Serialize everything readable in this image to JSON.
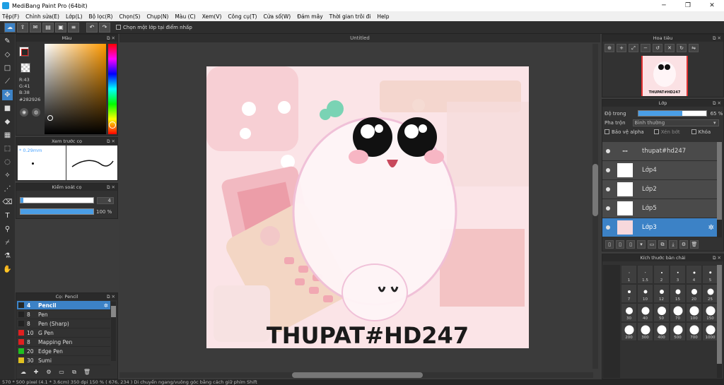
{
  "window": {
    "title": "MediBang Paint Pro (64bit)"
  },
  "menu": [
    "Tệp(F)",
    "Chỉnh sửa(E)",
    "Lớp(L)",
    "Bộ lọc(R)",
    "Chọn(S)",
    "Chụp(N)",
    "Màu (C)",
    "Xem(V)",
    "Công cụ(T)",
    "Cửa sổ(W)",
    "Đám mây",
    "Thời gian trôi đi",
    "Help"
  ],
  "toolbar": {
    "snap_label": "Chọn một lớp tại điểm nhấp"
  },
  "color_panel": {
    "title": "Màu",
    "r": "R:43",
    "g": "G:41",
    "b": "B:38",
    "hex": "#282926",
    "fg_color": "#282926",
    "base_hue": "#ff9a00"
  },
  "preview_panel": {
    "title": "Xem trước cọ",
    "size": "0.29mm"
  },
  "control_panel": {
    "title": "Kiểm soát cọ",
    "size_value": "4",
    "opacity_value": "100 %",
    "opacity_fraction": 1.0
  },
  "brush_panel": {
    "title": "Cọ: Pencil",
    "brushes": [
      {
        "num": "4",
        "name": "Pencil",
        "color": "#282926",
        "selected": true
      },
      {
        "num": "8",
        "name": "Pen",
        "color": "#222222"
      },
      {
        "num": "8",
        "name": "Pen (Sharp)",
        "color": "#222222"
      },
      {
        "num": "10",
        "name": "G Pen",
        "color": "#e02020"
      },
      {
        "num": "8",
        "name": "Mapping Pen",
        "color": "#e02020"
      },
      {
        "num": "20",
        "name": "Edge Pen",
        "color": "#20c020"
      },
      {
        "num": "30",
        "name": "Sumi",
        "color": "#e0c020"
      }
    ]
  },
  "canvas": {
    "tab_title": "Untitled",
    "watermark": "THUPAT#HD247"
  },
  "navigator": {
    "title": "Hoa tiêu",
    "thumb_label": "THUPAT#HD247"
  },
  "layer_panel": {
    "title": "Lớp",
    "opacity_label": "Độ trong",
    "opacity_value": "65 %",
    "opacity_fraction": 0.65,
    "blend_label": "Pha trộn",
    "blend_value": "Bình thường",
    "protect_alpha": "Bảo vệ alpha",
    "clipping": "Xén bớt",
    "lock": "Khóa",
    "layers": [
      {
        "name": "thupat#hd247",
        "selected": false
      },
      {
        "name": "Lớp4",
        "selected": false
      },
      {
        "name": "Lớp2",
        "selected": false
      },
      {
        "name": "Lớp5",
        "selected": false
      },
      {
        "name": "Lớp3",
        "selected": true
      }
    ]
  },
  "size_panel": {
    "title": "Kích thước bàn chải",
    "sizes": [
      "1",
      "1.5",
      "2",
      "3",
      "4",
      "5",
      "7",
      "10",
      "12",
      "15",
      "20",
      "25",
      "30",
      "40",
      "50",
      "70",
      "100",
      "150",
      "200",
      "300",
      "400",
      "500",
      "700",
      "1000"
    ]
  },
  "status": {
    "text": "570 * 500 pixel   (4.1 * 3.6cm)   350 dpi   150 %   ( 676, 234 )   Di chuyển ngang/vuông góc bằng cách giữ phím Shift"
  }
}
